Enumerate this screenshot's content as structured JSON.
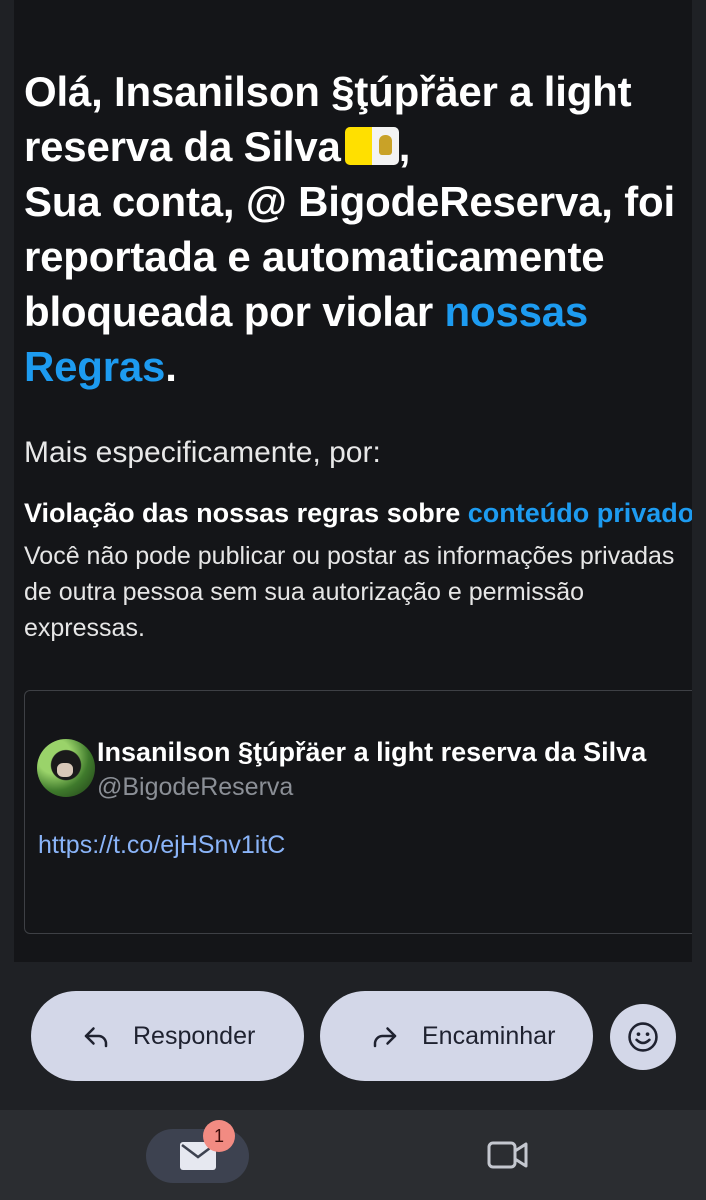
{
  "email": {
    "headline_lines": [
      "Olá, Insanilson §ţúpřäer a light",
      "reserva da Silva",
      ",",
      "Sua conta, @ BigodeReserva, foi",
      "reportada e automaticamente",
      "bloqueada por violar ",
      "nossas",
      "Regras",
      "."
    ],
    "intro": "Mais especificamente, por:",
    "rule_title_bold": "Violação das nossas regras sobre ",
    "rule_title_link": "conteúdo privado",
    "rule_desc_lines": [
      "Você não pode publicar ou postar as informações privadas",
      "de outra pessoa sem sua autorização e permissão",
      "expressas."
    ]
  },
  "tweet": {
    "name": "Insanilson §ţúpřäer a light reserva da Silva",
    "handle": "@BigodeReserva",
    "link": "https://t.co/ejHSnv1itC"
  },
  "actions": {
    "reply_label": "Responder",
    "forward_label": "Encaminhar"
  },
  "bottom_nav": {
    "mail_badge": "1"
  },
  "colors": {
    "link": "#1d9bf0",
    "button_bg": "#d3d7e8",
    "badge": "#f28b82"
  }
}
